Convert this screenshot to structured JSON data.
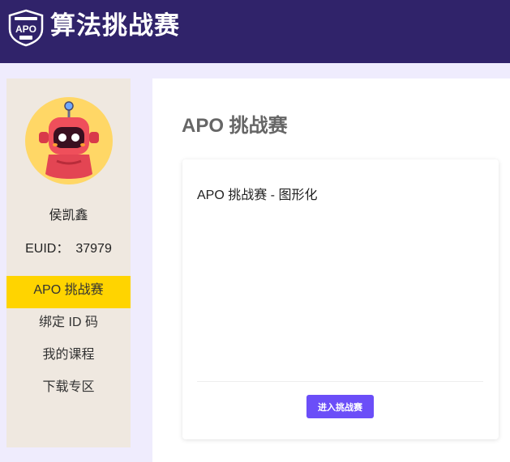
{
  "header": {
    "logo_text": "APO",
    "title": "算法挑战赛"
  },
  "sidebar": {
    "username": "侯凯鑫",
    "euid_label": "EUID：",
    "euid_value": "37979",
    "nav": [
      {
        "label": "APO 挑战赛",
        "active": true
      },
      {
        "label": "绑定 ID 码",
        "active": false
      },
      {
        "label": "我的课程",
        "active": false
      },
      {
        "label": "下载专区",
        "active": false
      }
    ]
  },
  "main": {
    "page_title": "APO 挑战赛",
    "card": {
      "title": "APO 挑战赛 - 图形化",
      "button_label": "进入挑战赛"
    }
  },
  "colors": {
    "header_bg": "#30236a",
    "page_bg": "#efecfd",
    "sidebar_bg": "#efe8e0",
    "active_nav": "#ffd400",
    "primary_button": "#6b4ef8"
  }
}
